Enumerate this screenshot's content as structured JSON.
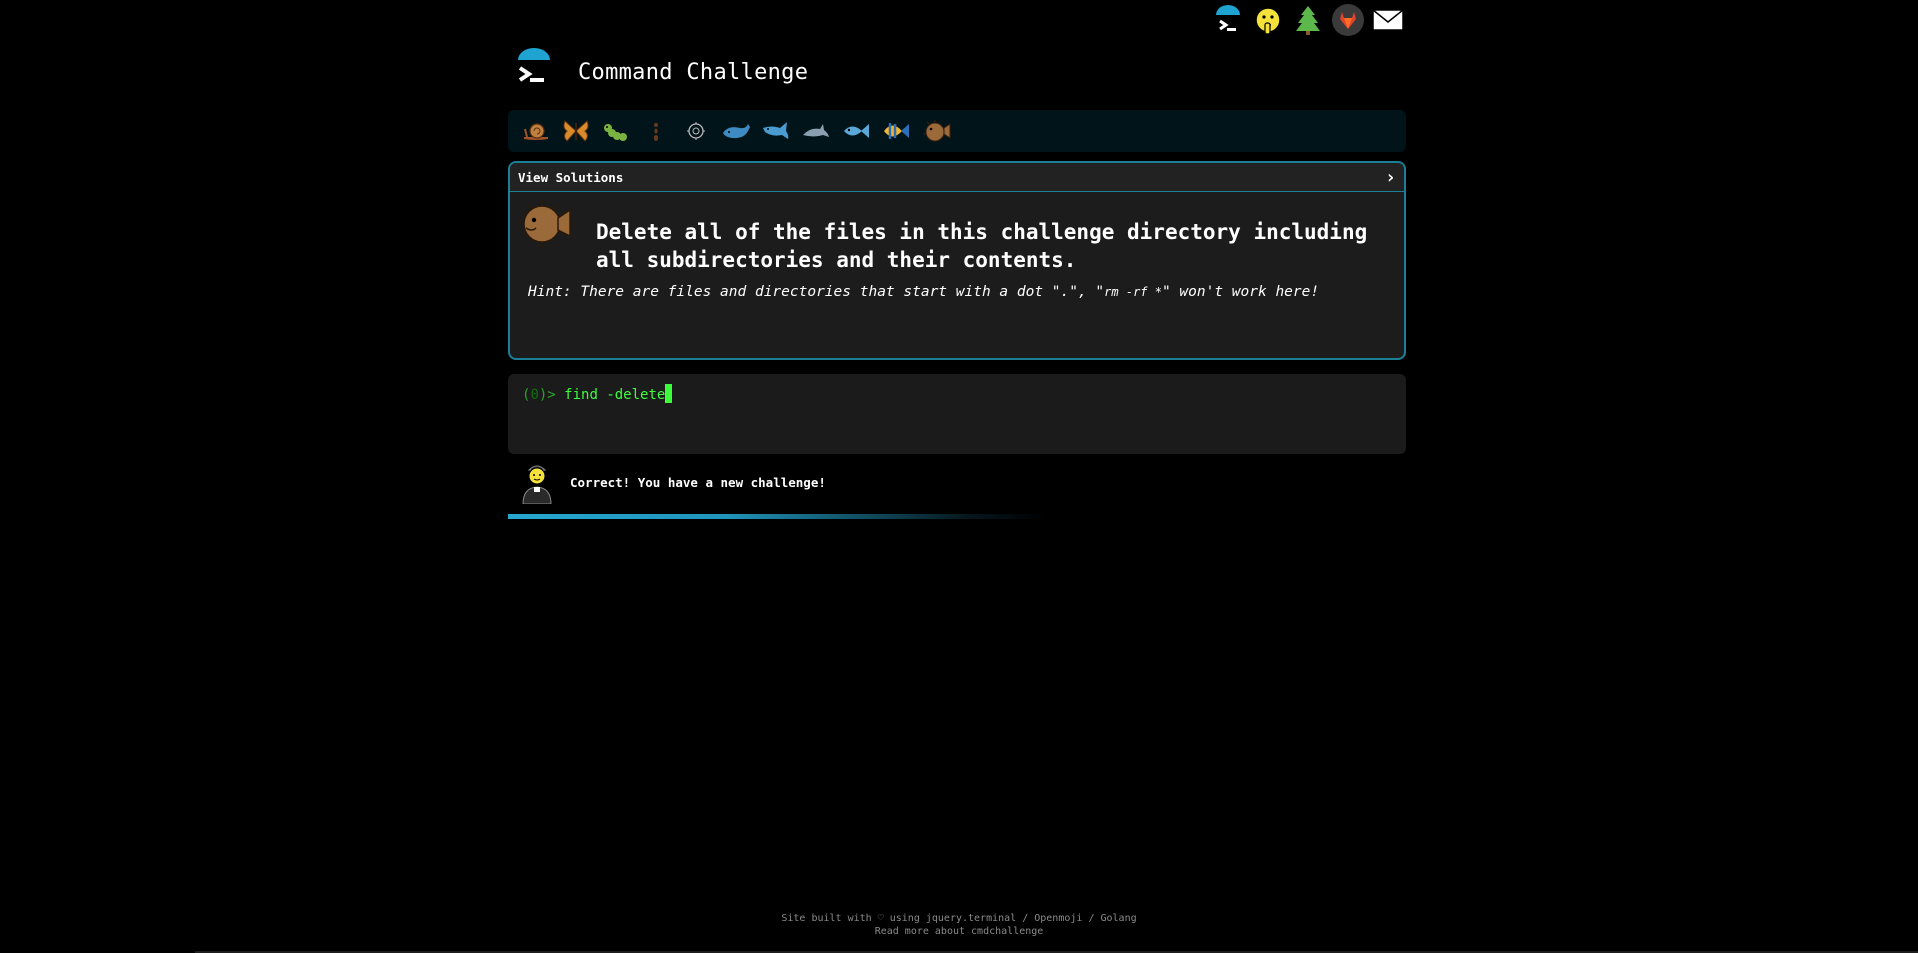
{
  "site": {
    "title": "Command Challenge"
  },
  "top_icons": [
    "terminal-umbrella-icon",
    "shushing-face-icon",
    "tree-icon",
    "gitlab-icon",
    "envelope-icon"
  ],
  "levels": [
    "snail-icon",
    "butterfly-icon",
    "caterpillar-icon",
    "ant-icon",
    "microbe-icon",
    "whale-icon",
    "shark-icon",
    "dolphin-icon",
    "fish-icon",
    "tropical-fish-icon",
    "blowfish-icon"
  ],
  "challenge": {
    "view_solutions": "View Solutions",
    "chevron": "›",
    "text": "Delete all of the files in this challenge directory including all subdirectories and their contents.",
    "hint_prefix": "Hint: There are files and directories that start with a dot \".\", \"",
    "hint_code": "rm -rf *",
    "hint_suffix": "\" won't work here!"
  },
  "terminal": {
    "prompt_open": "(",
    "prompt_num": "0",
    "prompt_close": ")>",
    "command": "find -delete"
  },
  "status": {
    "message": "Correct! You have a new challenge!",
    "progress": 0.6
  },
  "footer": {
    "line1_a": "Site built with ♡ using ",
    "link_jquery": "jquery.terminal",
    "sep1": " / ",
    "link_openmoji": "Openmoji",
    "sep2": " / ",
    "link_golang": "Golang",
    "line2": "Read more about cmdchallenge"
  },
  "colors": {
    "accent": "#1b7f96",
    "terminal_green": "#3cff3c",
    "progress": "#27a7cf"
  }
}
